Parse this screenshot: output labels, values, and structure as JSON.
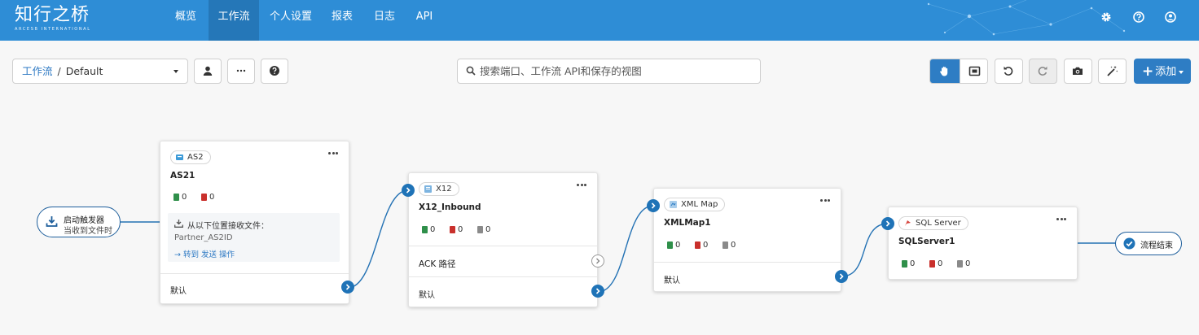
{
  "app": {
    "logo_text": "知行之桥",
    "logo_sub": "ARCESB INTERNATIONAL"
  },
  "nav": {
    "items": [
      {
        "label": "概览"
      },
      {
        "label": "工作流"
      },
      {
        "label": "个人设置"
      },
      {
        "label": "报表"
      },
      {
        "label": "日志"
      },
      {
        "label": "API"
      }
    ],
    "active_index": 1
  },
  "toolbar": {
    "breadcrumb_link": "工作流",
    "breadcrumb_sep": "/",
    "workspace": "Default",
    "search_placeholder": "搜索端口、工作流 API和保存的视图",
    "add_label": "添加"
  },
  "flow": {
    "trigger": {
      "title": "启动触发器",
      "subtitle": "当收到文件时"
    },
    "end": {
      "label": "流程结束"
    },
    "cards": [
      {
        "type": "AS2",
        "name": "AS21",
        "stats": [
          "0",
          "0"
        ],
        "receive_label": "从以下位置接收文件：",
        "receive_source": "Partner_AS2ID",
        "goto_action": "→ 转到 发送 操作",
        "default_label": "默认"
      },
      {
        "type": "X12",
        "name": "X12_Inbound",
        "stats": [
          "0",
          "0",
          "0"
        ],
        "ack_label": "ACK 路径",
        "default_label": "默认"
      },
      {
        "type": "XML Map",
        "name": "XMLMap1",
        "stats": [
          "0",
          "0",
          "0"
        ],
        "default_label": "默认"
      },
      {
        "type": "SQL Server",
        "name": "SQLServer1",
        "stats": [
          "0",
          "0",
          "0"
        ]
      }
    ]
  },
  "colors": {
    "nav_bg": "#2e8dd6",
    "nav_active": "#2577b8",
    "primary": "#2e7dc4",
    "port": "#1f73b7",
    "success": "#2f8f4a",
    "error": "#c9302c",
    "neutral": "#8a8a8a"
  }
}
